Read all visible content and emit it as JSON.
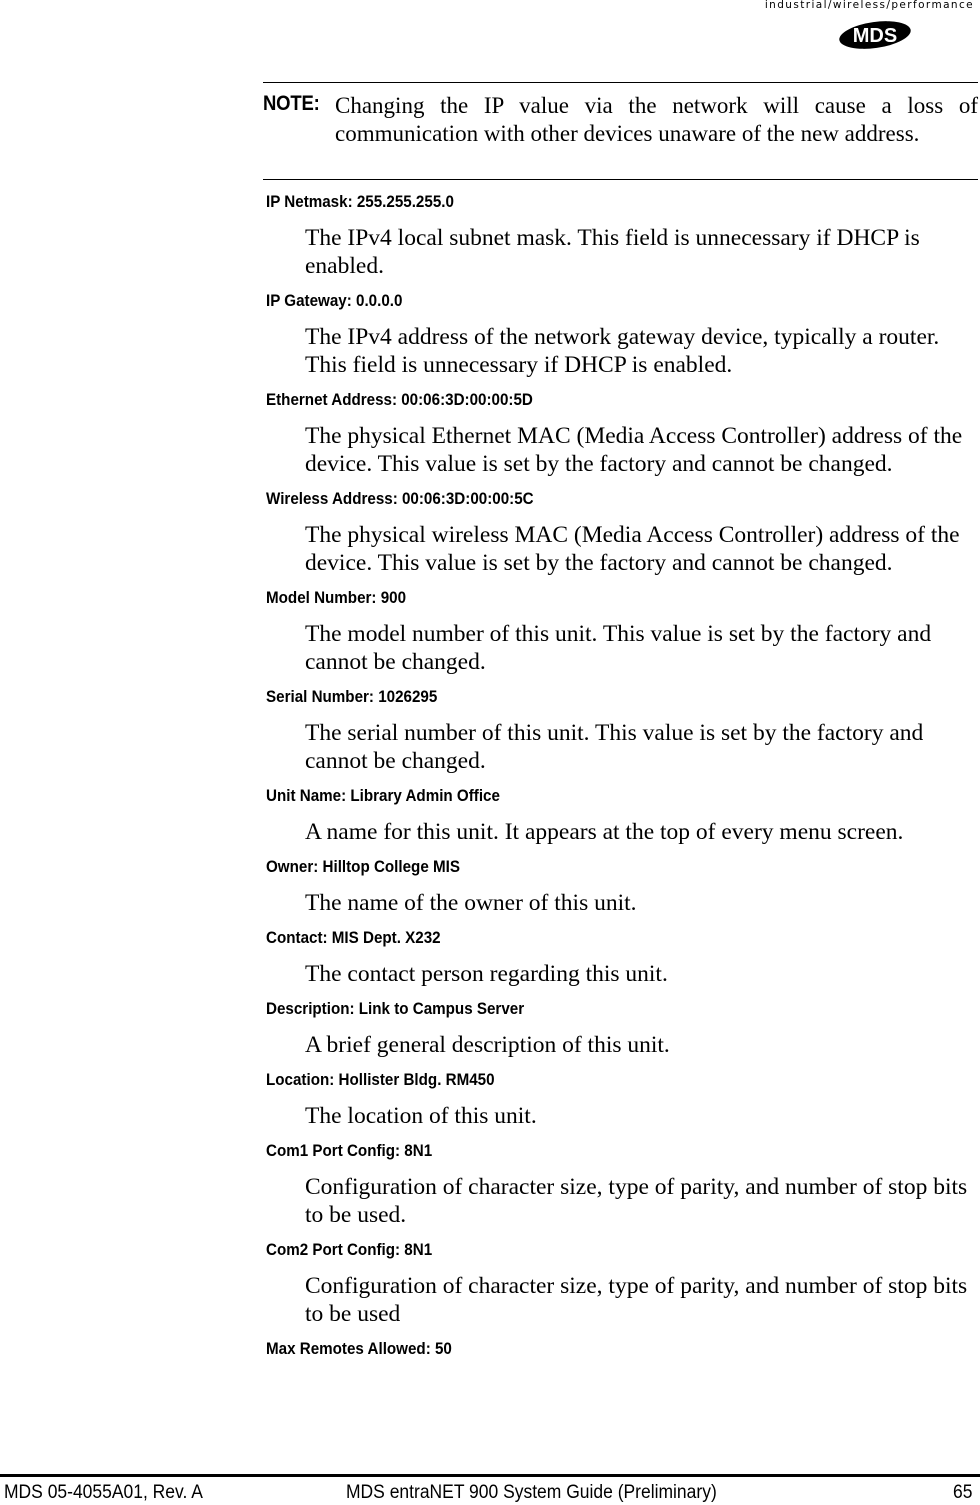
{
  "header": {
    "tagline": "industrial/wireless/performance",
    "logo_text": "MDS"
  },
  "note": {
    "label": "NOTE:",
    "text": "Changing the IP value via the network will cause a loss of communication with other devices unaware of the new address."
  },
  "fields": [
    {
      "label": "IP Netmask: 255.255.255.0",
      "desc": "The IPv4 local subnet mask. This field is unnecessary if DHCP is enabled."
    },
    {
      "label": "IP Gateway: 0.0.0.0",
      "desc": "The IPv4 address of the network gateway device, typically a router. This field is unnecessary if DHCP is enabled."
    },
    {
      "label": "Ethernet Address: 00:06:3D:00:00:5D",
      "desc": "The physical Ethernet MAC (Media Access Controller) address of the device. This value is set by the factory and cannot be changed."
    },
    {
      "label": "Wireless Address: 00:06:3D:00:00:5C",
      "desc": "The physical wireless MAC (Media Access Controller) address of the device. This value is set by the factory and cannot be changed."
    },
    {
      "label": "Model Number: 900",
      "desc": "The model number of this unit. This value is set by the factory and cannot be changed."
    },
    {
      "label": "Serial Number: 1026295",
      "desc": "The serial number of this unit. This value is set by the factory and cannot be changed."
    },
    {
      "label": "Unit Name: Library Admin Office",
      "desc": "A name for this unit. It appears at the top of every menu screen."
    },
    {
      "label": "Owner: Hilltop College MIS",
      "desc": "The name of the owner of this unit."
    },
    {
      "label": "Contact: MIS Dept. X232",
      "desc": "The contact person regarding this unit."
    },
    {
      "label": "Description: Link to Campus Server",
      "desc": "A brief general description of this unit."
    },
    {
      "label": "Location: Hollister Bldg. RM450",
      "desc": "The location of this unit."
    },
    {
      "label": "Com1 Port Config: 8N1",
      "desc": "Configuration of character size, type of parity, and number of stop bits to be used."
    },
    {
      "label": "Com2 Port Config: 8N1",
      "desc": "Configuration of character size, type of parity, and number of stop bits to be used"
    },
    {
      "label": "Max Remotes Allowed: 50",
      "desc": null
    }
  ],
  "footer": {
    "doc_number": "MDS 05-4055A01, Rev. A",
    "title": "MDS entraNET 900 System Guide (Preliminary)",
    "page_number": "65"
  }
}
